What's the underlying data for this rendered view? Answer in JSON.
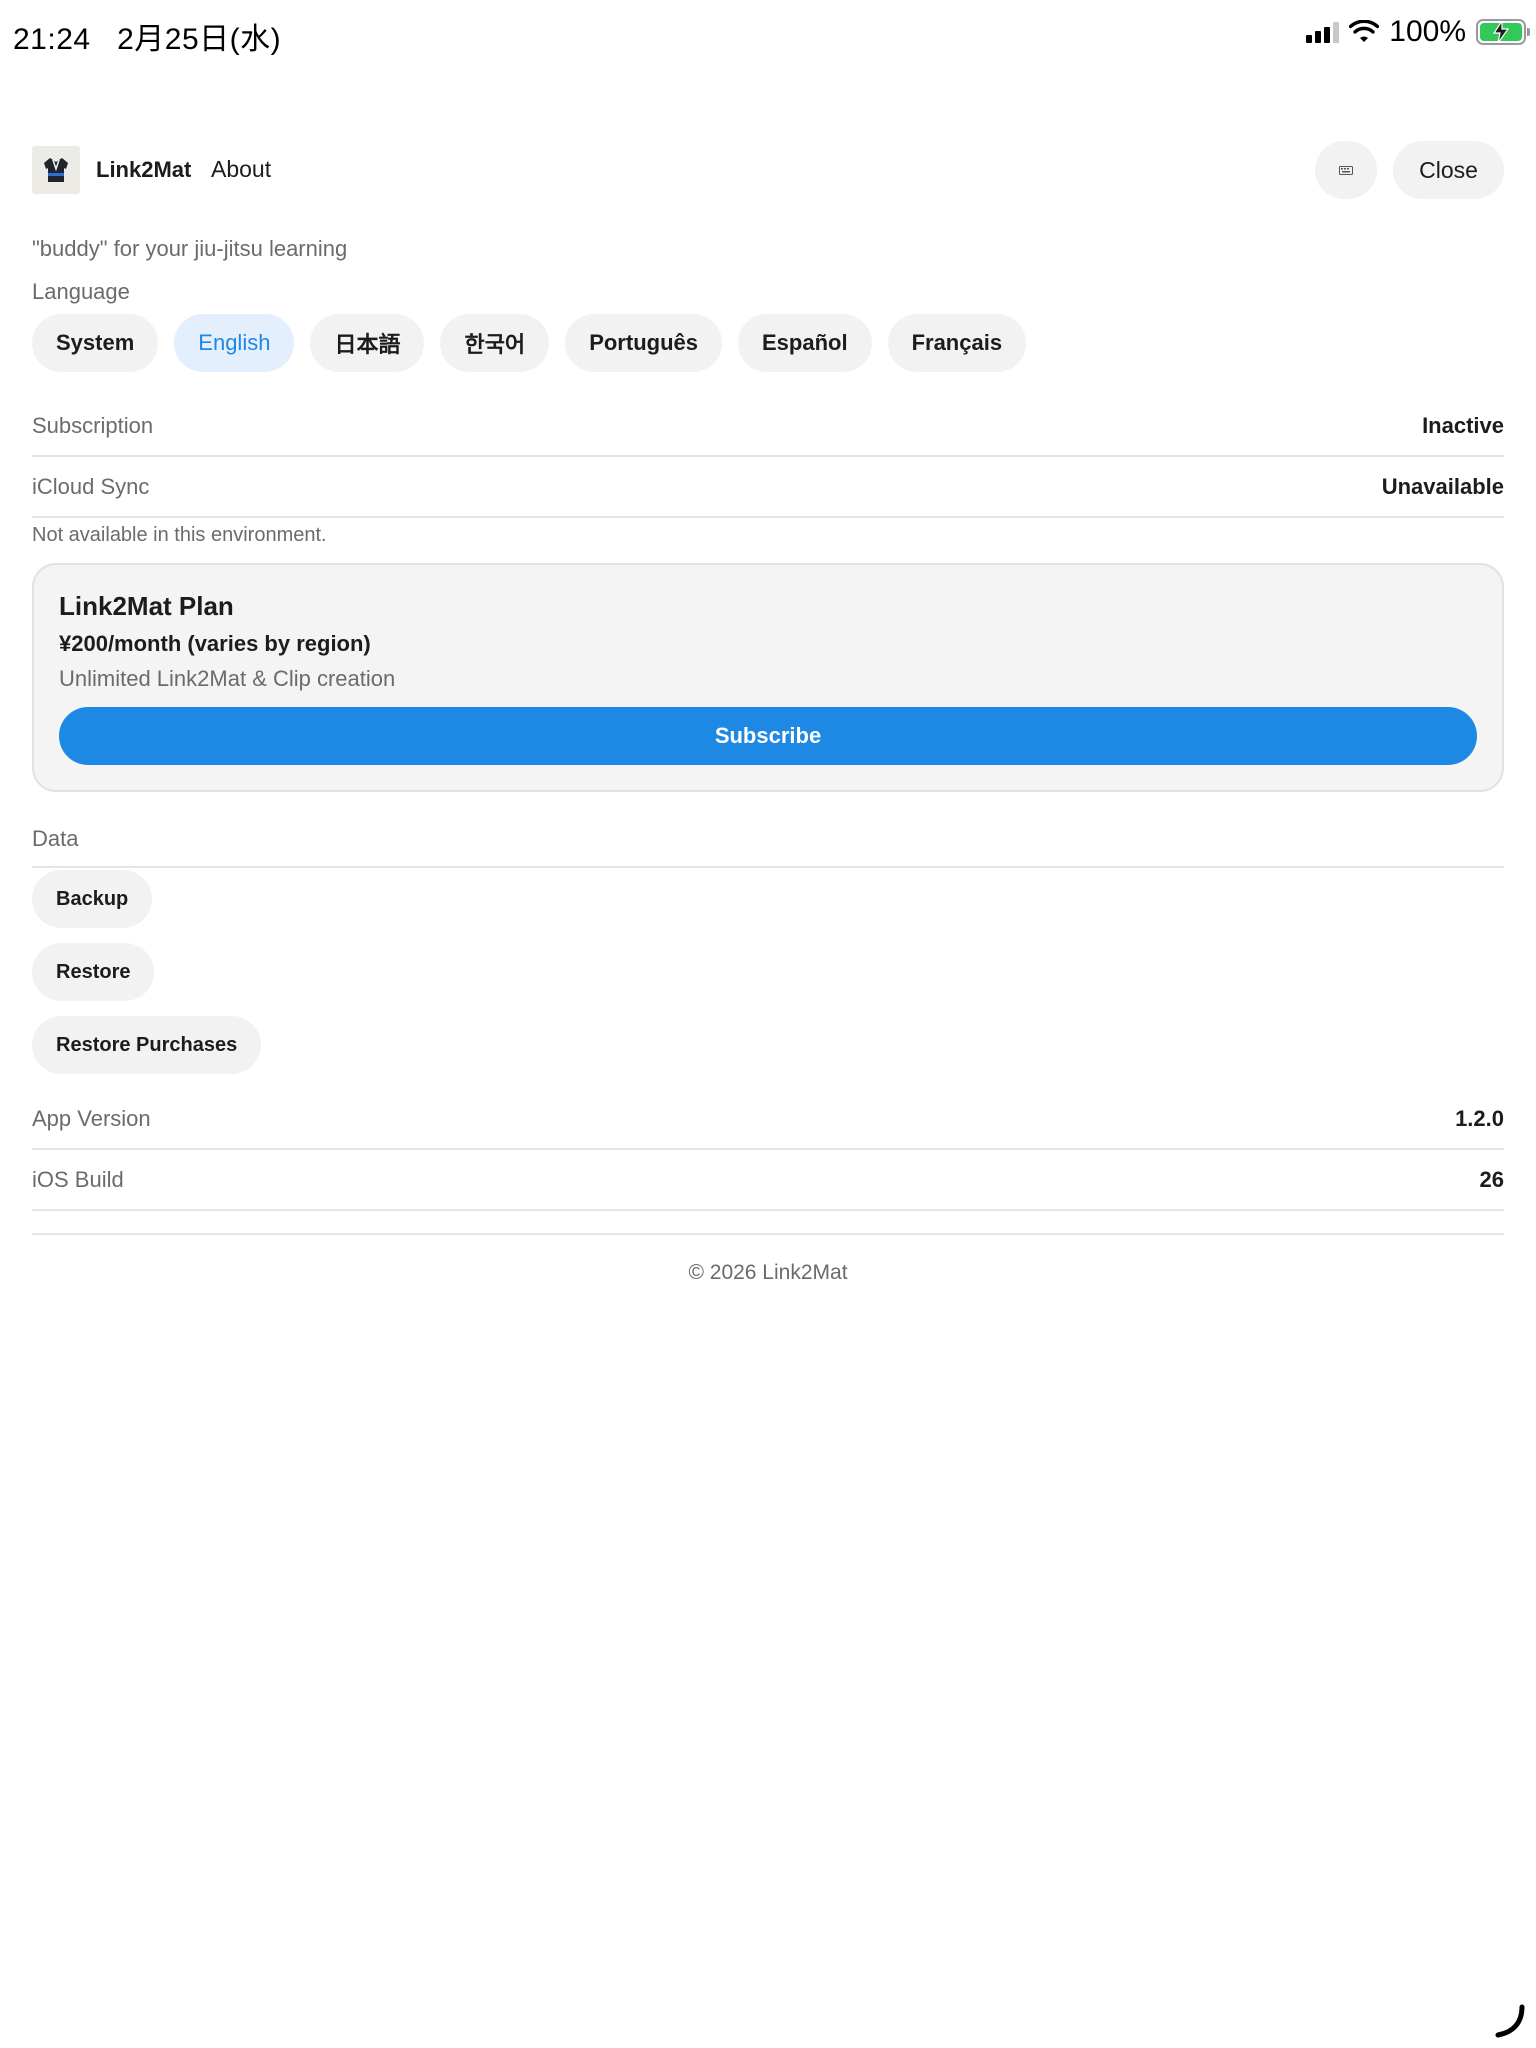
{
  "status_bar": {
    "time": "21:24",
    "date": "2月25日(水)",
    "battery_percent": "100%"
  },
  "header": {
    "app_name": "Link2Mat",
    "title": "About",
    "close_label": "Close"
  },
  "tagline": "\"buddy\" for your jiu-jitsu learning",
  "language": {
    "label": "Language",
    "selected": "English",
    "options": [
      "System",
      "English",
      "日本語",
      "한국어",
      "Português",
      "Español",
      "Français"
    ]
  },
  "subscription": {
    "label": "Subscription",
    "value": "Inactive"
  },
  "icloud": {
    "label": "iCloud Sync",
    "value": "Unavailable",
    "note": "Not available in this environment."
  },
  "plan": {
    "title": "Link2Mat Plan",
    "price": "¥200/month (varies by region)",
    "description": "Unlimited Link2Mat & Clip creation",
    "subscribe_label": "Subscribe"
  },
  "data_section": {
    "label": "Data",
    "backup_label": "Backup",
    "restore_label": "Restore",
    "restore_purchases_label": "Restore Purchases"
  },
  "app_version": {
    "label": "App Version",
    "value": "1.2.0"
  },
  "ios_build": {
    "label": "iOS Build",
    "value": "26"
  },
  "copyright": "© 2026 Link2Mat",
  "colors": {
    "accent": "#1e88e5",
    "pill_bg": "#f2f2f2",
    "active_pill_bg": "#e4effd",
    "battery_green": "#34c759"
  }
}
